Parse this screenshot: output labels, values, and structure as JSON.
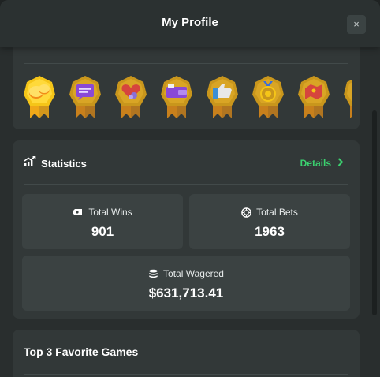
{
  "header": {
    "title": "My Profile",
    "close_glyph": "×"
  },
  "badges": {
    "faint_text": "\"",
    "items": [
      {
        "name": "coins-badge",
        "bg": "#f5c518",
        "accent": "#f28c18",
        "icon": "coins"
      },
      {
        "name": "chat-badge",
        "bg": "#c9961c",
        "accent": "#8a49d6",
        "icon": "chat"
      },
      {
        "name": "heart-badge",
        "bg": "#c9961c",
        "accent": "#d6453d",
        "icon": "heart"
      },
      {
        "name": "wallet-badge",
        "bg": "#c9961c",
        "accent": "#8a49d6",
        "icon": "wallet"
      },
      {
        "name": "thumbs-up-badge",
        "bg": "#c9961c",
        "accent": "#3d8fd6",
        "icon": "thumb"
      },
      {
        "name": "medal-badge",
        "bg": "#c9961c",
        "accent": "#3d6fd6",
        "icon": "medal"
      },
      {
        "name": "map-badge",
        "bg": "#c9961c",
        "accent": "#d6453d",
        "icon": "map"
      },
      {
        "name": "partial-badge",
        "bg": "#c9961c",
        "accent": "#c9961c",
        "icon": "none"
      }
    ]
  },
  "statistics": {
    "title": "Statistics",
    "details_label": "Details",
    "accent_color": "#3bd16f",
    "total_wins": {
      "label": "Total Wins",
      "value": "901"
    },
    "total_bets": {
      "label": "Total Bets",
      "value": "1963"
    },
    "total_wagered": {
      "label": "Total Wagered",
      "value": "$631,713.41"
    }
  },
  "favorites": {
    "title": "Top 3 Favorite Games"
  }
}
